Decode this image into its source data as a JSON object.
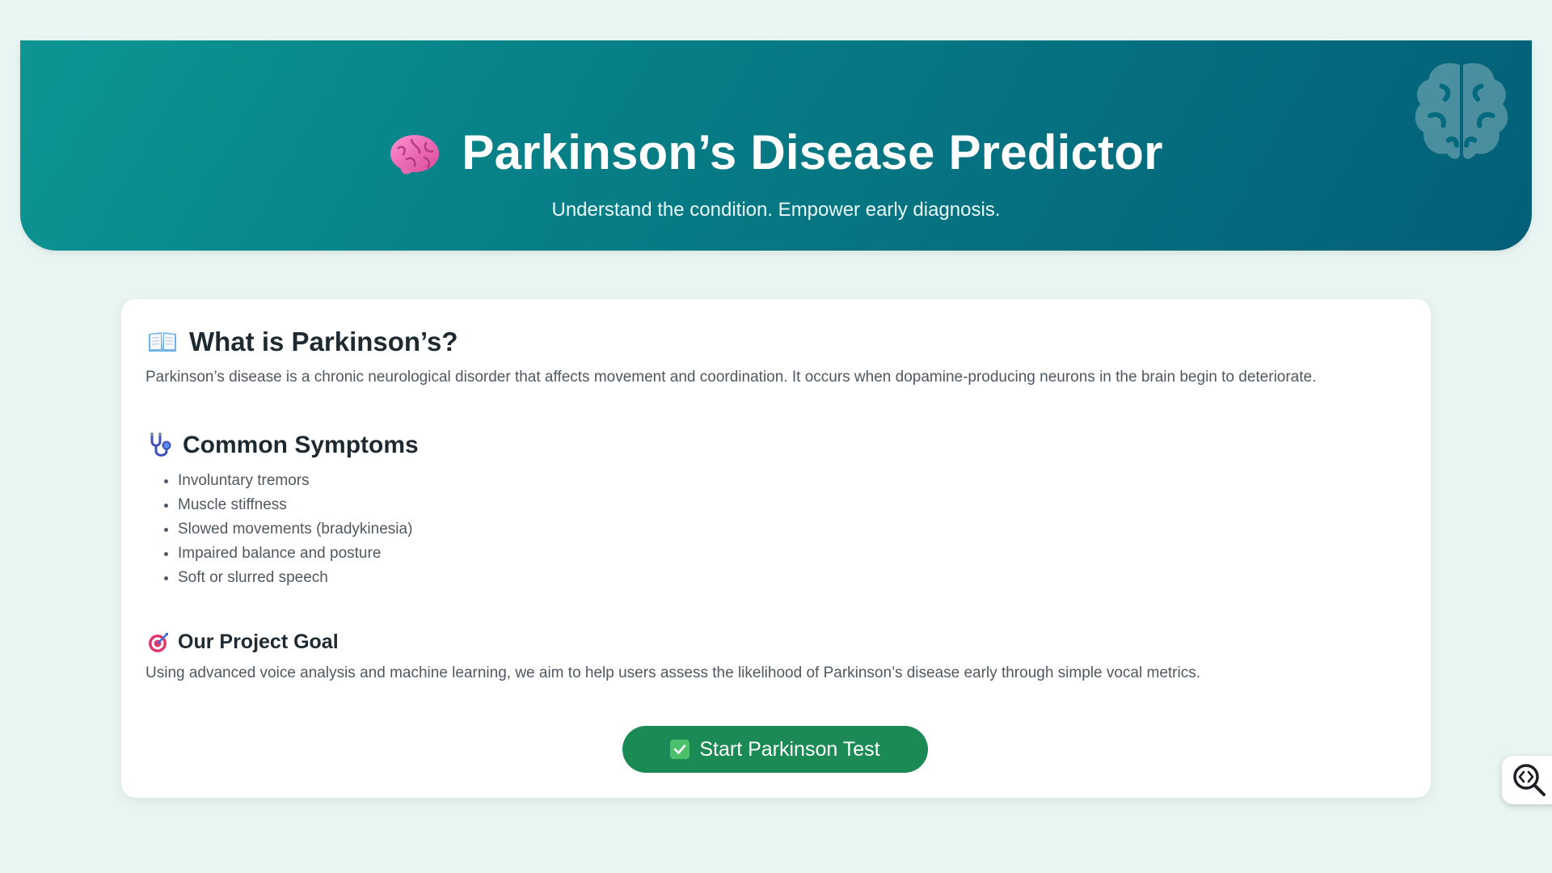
{
  "hero": {
    "title": "Parkinson’s Disease Predictor",
    "subtitle": "Understand the condition. Empower early diagnosis.",
    "title_icon": "brain-emoji-icon",
    "deco_icon": "brain-outline-icon",
    "gradient_start": "#0d9593",
    "gradient_end": "#035f78"
  },
  "what": {
    "icon": "open-book-icon",
    "heading": "What is Parkinson’s?",
    "text": "Parkinson’s disease is a chronic neurological disorder that affects movement and coordination. It occurs when dopamine-producing neurons in the brain begin to deteriorate."
  },
  "symptoms": {
    "icon": "stethoscope-icon",
    "heading": "Common Symptoms",
    "items": [
      "Involuntary tremors",
      "Muscle stiffness",
      "Slowed movements (bradykinesia)",
      "Impaired balance and posture",
      "Soft or slurred speech"
    ]
  },
  "goal": {
    "icon": "target-icon",
    "heading": "Our Project Goal",
    "text": "Using advanced voice analysis and machine learning, we aim to help users assess the likelihood of Parkinson’s disease early through simple vocal metrics."
  },
  "cta": {
    "icon": "check-box-icon",
    "label": "Start Parkinson Test",
    "color": "#1b8a55"
  },
  "floating": {
    "icon": "code-search-icon"
  },
  "colors": {
    "background": "#e8f5f2",
    "card": "#ffffff",
    "heading": "#1f2a30",
    "body_text": "#4f5860"
  }
}
